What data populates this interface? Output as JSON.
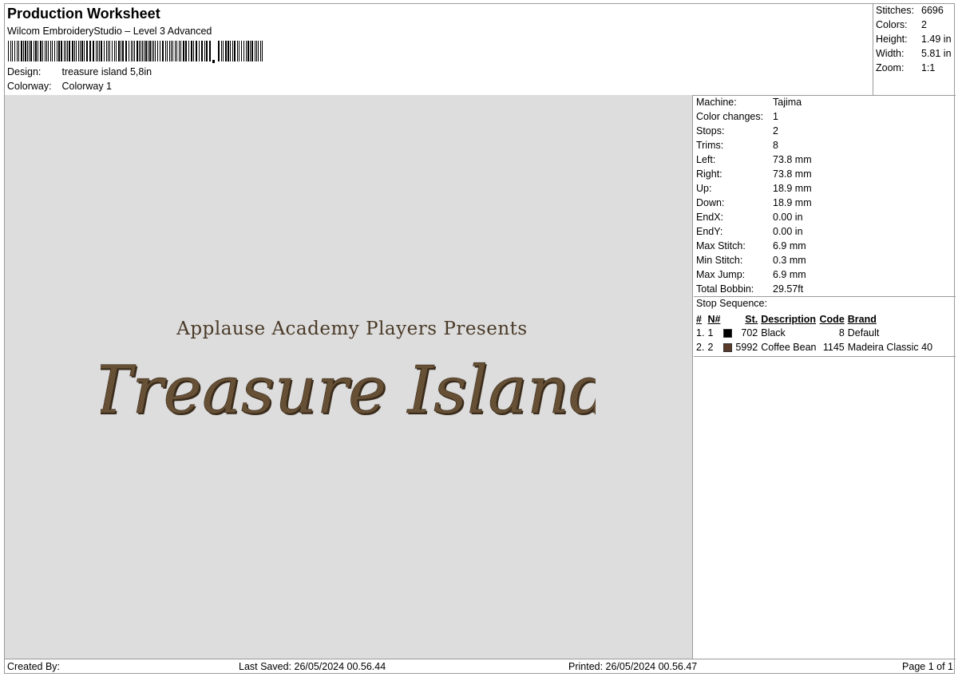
{
  "header": {
    "title": "Production Worksheet",
    "subtitle": "Wilcom EmbroideryStudio – Level 3 Advanced",
    "design_label": "Design:",
    "design_value": "treasure island 5,8in",
    "colorway_label": "Colorway:",
    "colorway_value": "Colorway 1"
  },
  "summary": [
    {
      "label": "Stitches:",
      "value": "6696"
    },
    {
      "label": "Colors:",
      "value": "2"
    },
    {
      "label": "Height:",
      "value": "1.49 in"
    },
    {
      "label": "Width:",
      "value": "5.81 in"
    },
    {
      "label": "Zoom:",
      "value": "1:1"
    }
  ],
  "design": {
    "line1": "Applause Academy Players Presents",
    "line2": "Treasure Island",
    "thread_color": "#6b5438",
    "thread_shadow": "#3a2c1c",
    "background": "#dddddd"
  },
  "info": [
    {
      "label": "Machine:",
      "value": "Tajima"
    },
    {
      "label": "Color changes:",
      "value": "1"
    },
    {
      "label": "Stops:",
      "value": "2"
    },
    {
      "label": "Trims:",
      "value": "8"
    },
    {
      "label": "Left:",
      "value": "73.8 mm"
    },
    {
      "label": "Right:",
      "value": "73.8 mm"
    },
    {
      "label": "Up:",
      "value": "18.9 mm"
    },
    {
      "label": "Down:",
      "value": "18.9 mm"
    },
    {
      "label": "EndX:",
      "value": "0.00 in"
    },
    {
      "label": "EndY:",
      "value": "0.00 in"
    },
    {
      "label": "Max Stitch:",
      "value": "6.9 mm"
    },
    {
      "label": "Min Stitch:",
      "value": "0.3 mm"
    },
    {
      "label": "Max Jump:",
      "value": "6.9 mm"
    },
    {
      "label": "Total Bobbin:",
      "value": "29.57ft"
    }
  ],
  "stop_sequence": {
    "title": "Stop Sequence:",
    "headers": [
      "#",
      "N#",
      "St.",
      "Description",
      "Code",
      "Brand"
    ],
    "rows": [
      {
        "num": "1.",
        "n": "1",
        "color": "#000000",
        "st": "702",
        "description": "Black",
        "code": "8",
        "brand": "Default"
      },
      {
        "num": "2.",
        "n": "2",
        "color": "#5a3a2a",
        "st": "5992",
        "description": "Coffee Bean",
        "code": "1145",
        "brand": "Madeira Classic 40"
      }
    ]
  },
  "footer": {
    "created_by": "Created By:",
    "last_saved": "Last Saved: 26/05/2024 00.56.44",
    "printed": "Printed: 26/05/2024 00.56.47",
    "page": "Page 1 of 1"
  }
}
